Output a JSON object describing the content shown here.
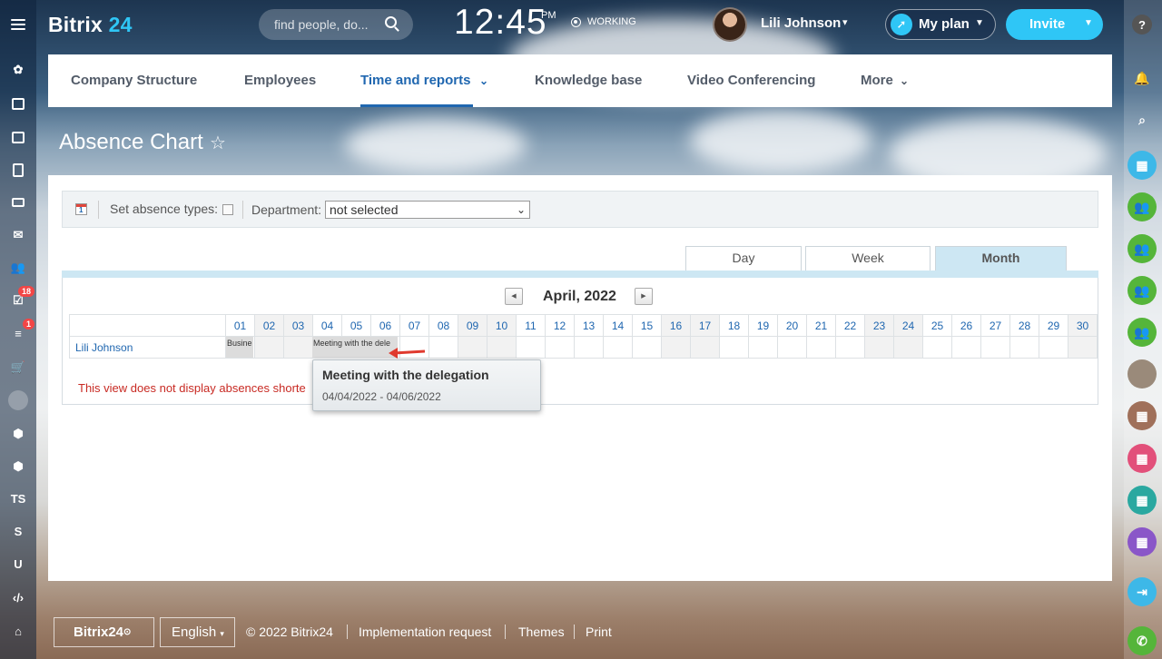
{
  "header": {
    "logo_text": "Bitrix",
    "logo_num": "24",
    "search_placeholder": "find people, do...",
    "clock": "12:45",
    "clock_suffix": "PM",
    "status": "WORKING",
    "user_name": "Lili Johnson",
    "myplan_label": "My plan",
    "invite_label": "Invite"
  },
  "left_bar": {
    "badges": [
      "18",
      "1"
    ],
    "labels": [
      "TS",
      "S",
      "U"
    ]
  },
  "nav": {
    "items": [
      "Company Structure",
      "Employees",
      "Time and reports",
      "Knowledge base",
      "Video Conferencing",
      "More"
    ]
  },
  "page": {
    "title": "Absence Chart"
  },
  "toolbar": {
    "set_absence_label": "Set absence types:",
    "department_label": "Department:",
    "department_value": "not selected"
  },
  "view_tabs": [
    "Day",
    "Week",
    "Month"
  ],
  "chart": {
    "month": "April, 2022",
    "days": [
      "01",
      "02",
      "03",
      "04",
      "05",
      "06",
      "07",
      "08",
      "09",
      "10",
      "11",
      "12",
      "13",
      "14",
      "15",
      "16",
      "17",
      "18",
      "19",
      "20",
      "21",
      "22",
      "23",
      "24",
      "25",
      "26",
      "27",
      "28",
      "29",
      "30"
    ],
    "employee": "Lili Johnson",
    "absence_1": "Busine",
    "absence_2": "Meeting with the dele",
    "notice": "This view does not display absences shorte"
  },
  "tooltip": {
    "title": "Meeting with the delegation",
    "dates": "04/04/2022 - 04/06/2022"
  },
  "footer": {
    "logo": "Bitrix24",
    "language": "English",
    "copyright": "© 2022 Bitrix24",
    "implementation": "Implementation request",
    "themes": "Themes",
    "print": "Print"
  },
  "colors": {
    "accent": "#2fc6f6",
    "link": "#2067b0",
    "notice": "#c82a23"
  }
}
